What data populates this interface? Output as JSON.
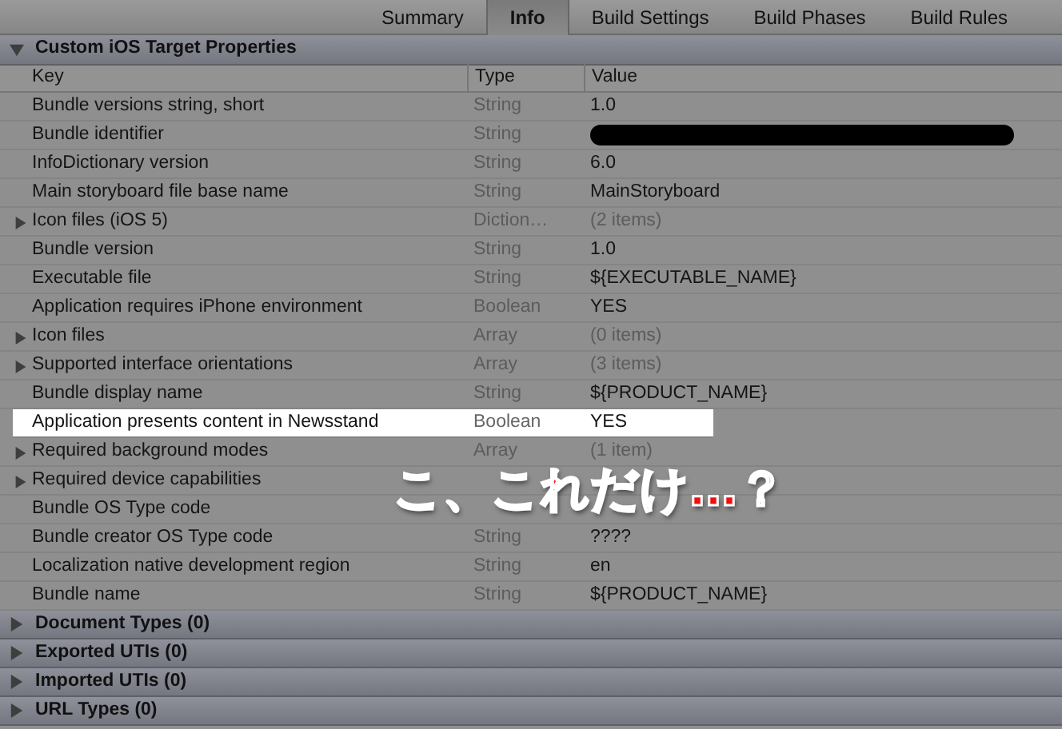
{
  "tabs": [
    {
      "label": "Summary",
      "selected": false
    },
    {
      "label": "Info",
      "selected": true
    },
    {
      "label": "Build Settings",
      "selected": false
    },
    {
      "label": "Build Phases",
      "selected": false
    },
    {
      "label": "Build Rules",
      "selected": false
    }
  ],
  "section": {
    "title": "Custom iOS Target Properties",
    "expanded": true
  },
  "columns": [
    "Key",
    "Type",
    "Value"
  ],
  "rows": [
    {
      "key": "Bundle versions string, short",
      "type": "String",
      "value": "1.0",
      "expandable": false,
      "highlighted": false,
      "redacted": false
    },
    {
      "key": "Bundle identifier",
      "type": "String",
      "expandable": false,
      "highlighted": false,
      "redacted": true
    },
    {
      "key": "InfoDictionary version",
      "type": "String",
      "value": "6.0",
      "expandable": false,
      "highlighted": false,
      "redacted": false
    },
    {
      "key": "Main storyboard file base name",
      "type": "String",
      "value": "MainStoryboard",
      "expandable": false,
      "highlighted": false,
      "redacted": false
    },
    {
      "key": "Icon files (iOS 5)",
      "type": "Diction…",
      "value": "(2 items)",
      "expandable": true,
      "highlighted": false,
      "redacted": false
    },
    {
      "key": "Bundle version",
      "type": "String",
      "value": "1.0",
      "expandable": false,
      "highlighted": false,
      "redacted": false
    },
    {
      "key": "Executable file",
      "type": "String",
      "value": "${EXECUTABLE_NAME}",
      "expandable": false,
      "highlighted": false,
      "redacted": false
    },
    {
      "key": "Application requires iPhone environment",
      "type": "Boolean",
      "value": "YES",
      "expandable": false,
      "highlighted": false,
      "redacted": false
    },
    {
      "key": "Icon files",
      "type": "Array",
      "value": "(0 items)",
      "expandable": true,
      "highlighted": false,
      "redacted": false
    },
    {
      "key": "Supported interface orientations",
      "type": "Array",
      "value": "(3 items)",
      "expandable": true,
      "highlighted": false,
      "redacted": false
    },
    {
      "key": "Bundle display name",
      "type": "String",
      "value": "${PRODUCT_NAME}",
      "expandable": false,
      "highlighted": false,
      "redacted": false
    },
    {
      "key": "Application presents content in Newsstand",
      "type": "Boolean",
      "value": "YES",
      "expandable": false,
      "highlighted": true,
      "redacted": false
    },
    {
      "key": "Required background modes",
      "type": "Array",
      "value": "(1 item)",
      "expandable": true,
      "highlighted": false,
      "redacted": false
    },
    {
      "key": "Required device capabilities",
      "expandable": true,
      "highlighted": false,
      "redacted": false
    },
    {
      "key": "Bundle OS Type code",
      "expandable": false,
      "highlighted": false,
      "redacted": false
    },
    {
      "key": "Bundle creator OS Type code",
      "type": "String",
      "value": "????",
      "expandable": false,
      "highlighted": false,
      "redacted": false
    },
    {
      "key": "Localization native development region",
      "type": "String",
      "value": "en",
      "expandable": false,
      "highlighted": false,
      "redacted": false
    },
    {
      "key": "Bundle name",
      "type": "String",
      "value": "${PRODUCT_NAME}",
      "expandable": false,
      "highlighted": false,
      "redacted": false
    }
  ],
  "collapsed_sections": [
    {
      "title": "Document Types (0)",
      "expanded": false
    },
    {
      "title": "Exported UTIs (0)",
      "expanded": false
    },
    {
      "title": "Imported UTIs (0)",
      "expanded": false
    },
    {
      "title": "URL Types (0)",
      "expanded": false
    }
  ],
  "annotation": "こ、これだけ…？"
}
